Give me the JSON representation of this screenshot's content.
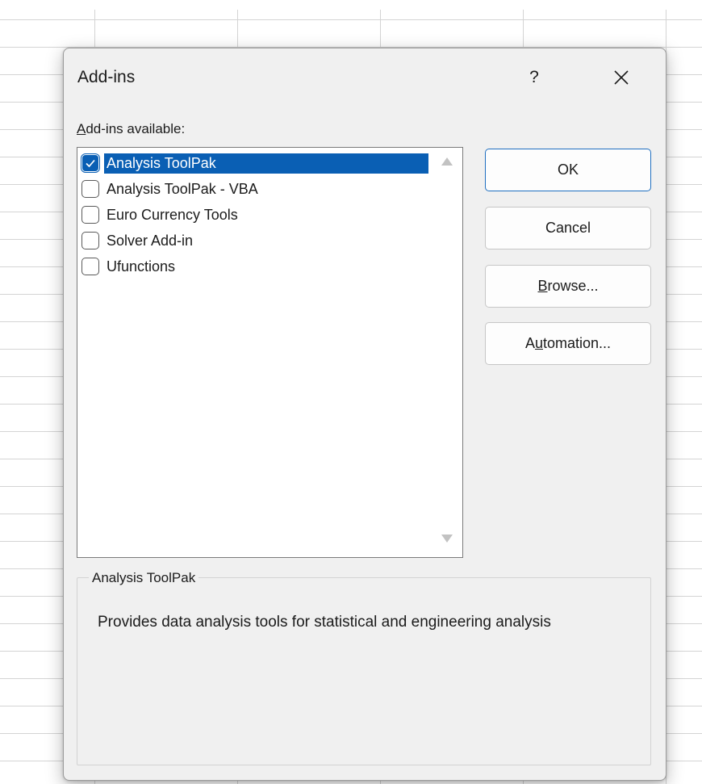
{
  "dialog": {
    "title": "Add-ins",
    "help_label": "?",
    "close_icon": "close-icon",
    "list_label_prefix": "A",
    "list_label_rest": "dd-ins available:",
    "addins": [
      {
        "label": "Analysis ToolPak",
        "checked": true,
        "selected": true
      },
      {
        "label": "Analysis ToolPak - VBA",
        "checked": false,
        "selected": false
      },
      {
        "label": "Euro Currency Tools",
        "checked": false,
        "selected": false
      },
      {
        "label": "Solver Add-in",
        "checked": false,
        "selected": false
      },
      {
        "label": "Ufunctions",
        "checked": false,
        "selected": false
      }
    ],
    "buttons": {
      "ok": "OK",
      "cancel": "Cancel",
      "browse_prefix": "B",
      "browse_rest": "rowse...",
      "automation_prefix": "A",
      "automation_u": "u",
      "automation_rest": "tomation..."
    },
    "description": {
      "group_title": "Analysis ToolPak",
      "text": "Provides data analysis tools for statistical and engineering analysis"
    }
  },
  "colors": {
    "accent": "#0a5fb4",
    "dialog_bg": "#f0f0f0"
  }
}
